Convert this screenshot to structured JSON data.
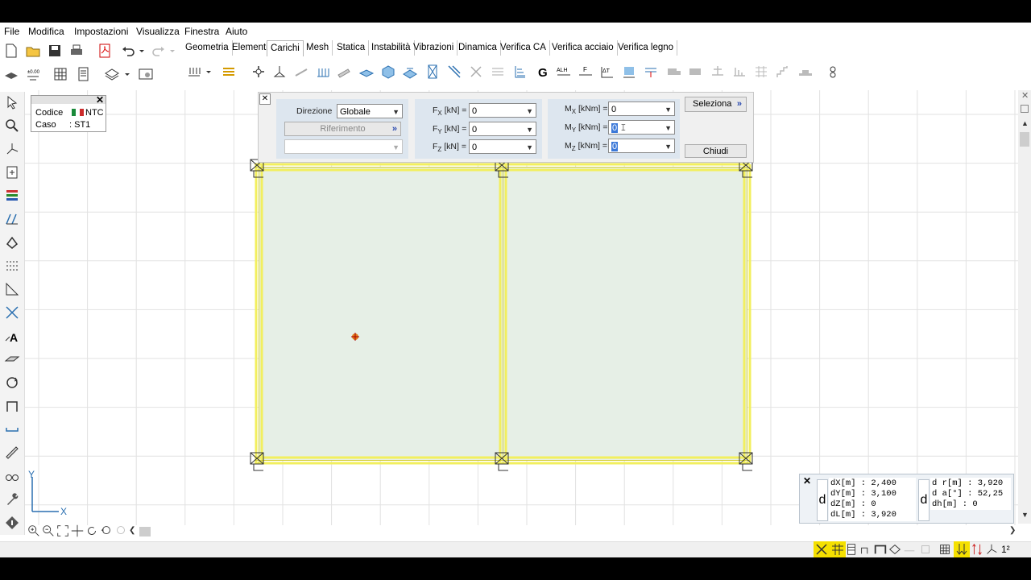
{
  "menu": [
    "File",
    "Modifica",
    "Impostazioni",
    "Visualizza",
    "Finestra",
    "Aiuto"
  ],
  "tabs": [
    {
      "label": "Geometria",
      "active": false
    },
    {
      "label": "Elementi",
      "active": false
    },
    {
      "label": "Carichi",
      "active": true
    },
    {
      "label": "Mesh",
      "active": false
    },
    {
      "label": "Statica",
      "active": false
    },
    {
      "label": "Instabilità",
      "active": false
    },
    {
      "label": "Vibrazioni",
      "active": false
    },
    {
      "label": "Dinamica",
      "active": false
    },
    {
      "label": "Verifica CA",
      "active": false
    },
    {
      "label": "Verifica acciaio",
      "active": false
    },
    {
      "label": "Verifica legno",
      "active": false
    }
  ],
  "code_box": {
    "codice_label": "Codice",
    "codice_value": "NTC",
    "caso_label": "Caso",
    "caso_value": ": ST1"
  },
  "load_panel": {
    "direzione_label": "Direzione",
    "direzione_value": "Globale",
    "riferimento_label": "Riferimento",
    "fx_label": "[kN] =",
    "fx_value": "0",
    "fy_label": "[kN] =",
    "fy_value": "0",
    "fz_label": "[kN] =",
    "fz_value": "0",
    "mx_label": "[kNm] =",
    "mx_value": "0",
    "my_label": "[kNm] =",
    "my_value": "0",
    "mz_label": "[kNm] =",
    "mz_value": "0",
    "seleziona_label": "Seleziona",
    "chiudi_label": "Chiudi"
  },
  "axes": {
    "x": "X",
    "y": "Y"
  },
  "info1": {
    "dx": "dX[m] : 2,400",
    "dy": "dY[m] : 3,100",
    "dz": "dZ[m] : 0",
    "dl": "dL[m] : 3,920"
  },
  "info2": {
    "dr": "d r[m] : 3,920",
    "da": "d a[°] : 52,25",
    "dh": "dh[m] : 0"
  },
  "info_letter": "d",
  "status_text": "1²",
  "colors": {
    "frame": "#f2ef5e",
    "slab": "#e6efe6",
    "panel_group": "#dde6ef",
    "grid": "#e2e2e2"
  }
}
